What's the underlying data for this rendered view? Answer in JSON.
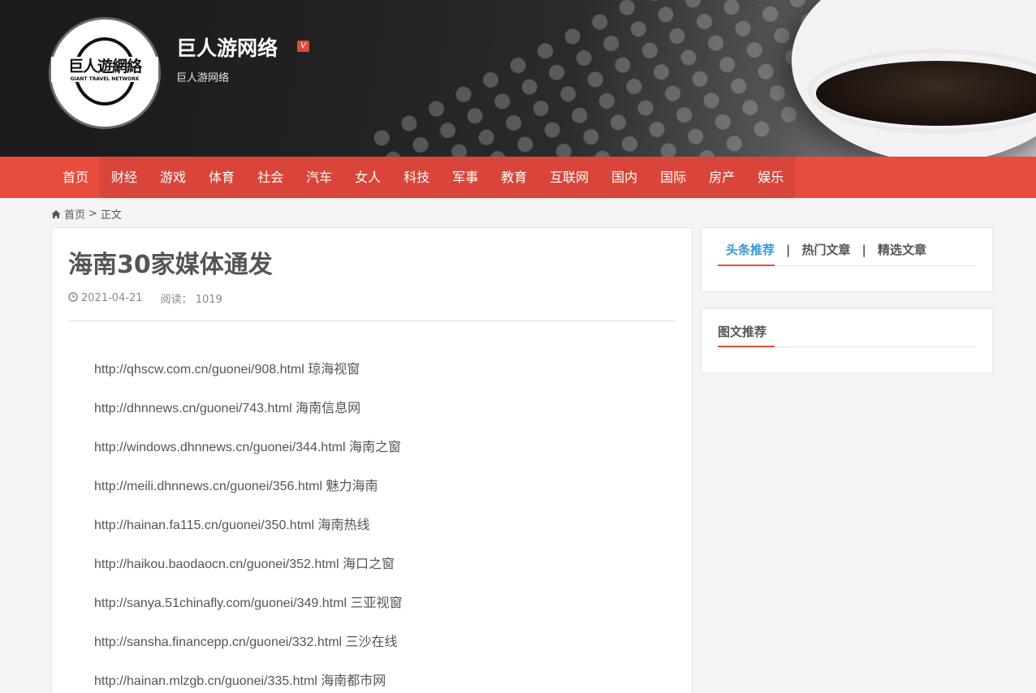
{
  "header": {
    "logo_text": "巨人遊網絡",
    "logo_subtext": "GIANT TRAVEL NETWORK",
    "site_title": "巨人游网络",
    "verified_badge": "V",
    "site_subtitle": "巨人游网络"
  },
  "nav": {
    "items": [
      "首页",
      "财经",
      "游戏",
      "体育",
      "社会",
      "汽车",
      "女人",
      "科技",
      "军事",
      "教育",
      "互联网",
      "国内",
      "国际",
      "房产",
      "娱乐"
    ]
  },
  "breadcrumb": {
    "home": "首页",
    "separator": ">",
    "current": "正文"
  },
  "article": {
    "title": "海南30家媒体通发",
    "date": "2021-04-21",
    "read_label": "阅读：",
    "read_count": "1019",
    "lines": [
      "http://qhscw.com.cn/guonei/908.html 琼海视窗",
      "http://dhnnews.cn/guonei/743.html 海南信息网",
      "http://windows.dhnnews.cn/guonei/344.html 海南之窗",
      "http://meili.dhnnews.cn/guonei/356.html 魅力海南",
      "http://hainan.fa115.cn/guonei/350.html 海南热线",
      "http://haikou.baodaocn.cn/guonei/352.html 海口之窗",
      "http://sanya.51chinafly.com/guonei/349.html 三亚视窗",
      "http://sansha.financepp.cn/guonei/332.html 三沙在线",
      "http://hainan.mlzgb.cn/guonei/335.html 海南都市网"
    ]
  },
  "sidebar": {
    "tabs": [
      "头条推荐",
      "热门文章",
      "精选文章"
    ],
    "tab_separator": "|",
    "image_recommend_title": "图文推荐"
  },
  "colors": {
    "nav_bg": "#e74c3c",
    "accent_blue": "#3498db",
    "badge_red": "#e04a3a"
  }
}
